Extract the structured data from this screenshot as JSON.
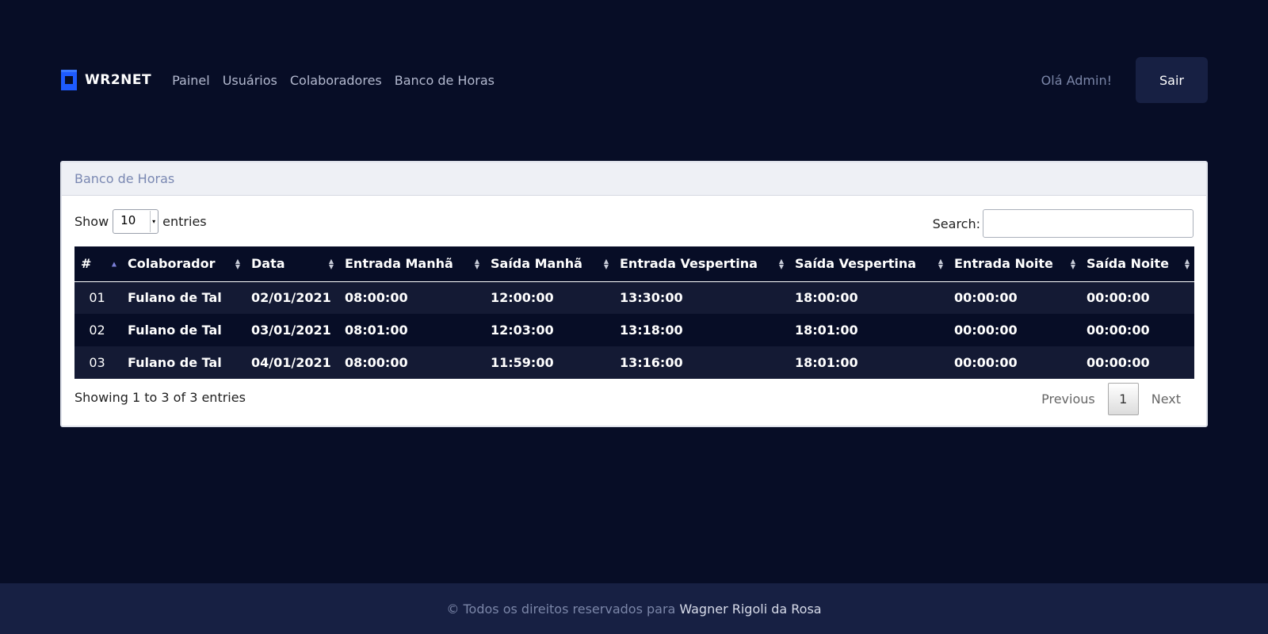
{
  "brand": {
    "logo_text": "WR2NET",
    "icon": "wr2net-logo-icon"
  },
  "nav": {
    "links": [
      {
        "label": "Painel"
      },
      {
        "label": "Usuários"
      },
      {
        "label": "Colaboradores"
      },
      {
        "label": "Banco de Horas"
      }
    ],
    "greeting": "Olá Admin!",
    "logout_label": "Sair"
  },
  "card": {
    "title": "Banco de Horas",
    "length": {
      "show_label": "Show",
      "selected": "10",
      "entries_label": "entries"
    },
    "search": {
      "label": "Search:",
      "value": "",
      "placeholder": ""
    },
    "table": {
      "columns": [
        "#",
        "Colaborador",
        "Data",
        "Entrada Manhã",
        "Saída Manhã",
        "Entrada Vespertina",
        "Saída Vespertina",
        "Entrada Noite",
        "Saída Noite"
      ],
      "rows": [
        [
          "01",
          "Fulano de Tal",
          "02/01/2021",
          "08:00:00",
          "12:00:00",
          "13:30:00",
          "18:00:00",
          "00:00:00",
          "00:00:00"
        ],
        [
          "02",
          "Fulano de Tal",
          "03/01/2021",
          "08:01:00",
          "12:03:00",
          "13:18:00",
          "18:01:00",
          "00:00:00",
          "00:00:00"
        ],
        [
          "03",
          "Fulano de Tal",
          "04/01/2021",
          "08:00:00",
          "11:59:00",
          "13:16:00",
          "18:01:00",
          "00:00:00",
          "00:00:00"
        ]
      ]
    },
    "info": "Showing 1 to 3 of 3 entries",
    "pagination": {
      "previous": "Previous",
      "current": "1",
      "next": "Next"
    }
  },
  "footer": {
    "text": "© Todos os direitos reservados para",
    "author": "Wagner Rigoli da Rosa"
  },
  "colors": {
    "background": "#070d26",
    "accent": "#1e5bff",
    "button": "#172043"
  }
}
